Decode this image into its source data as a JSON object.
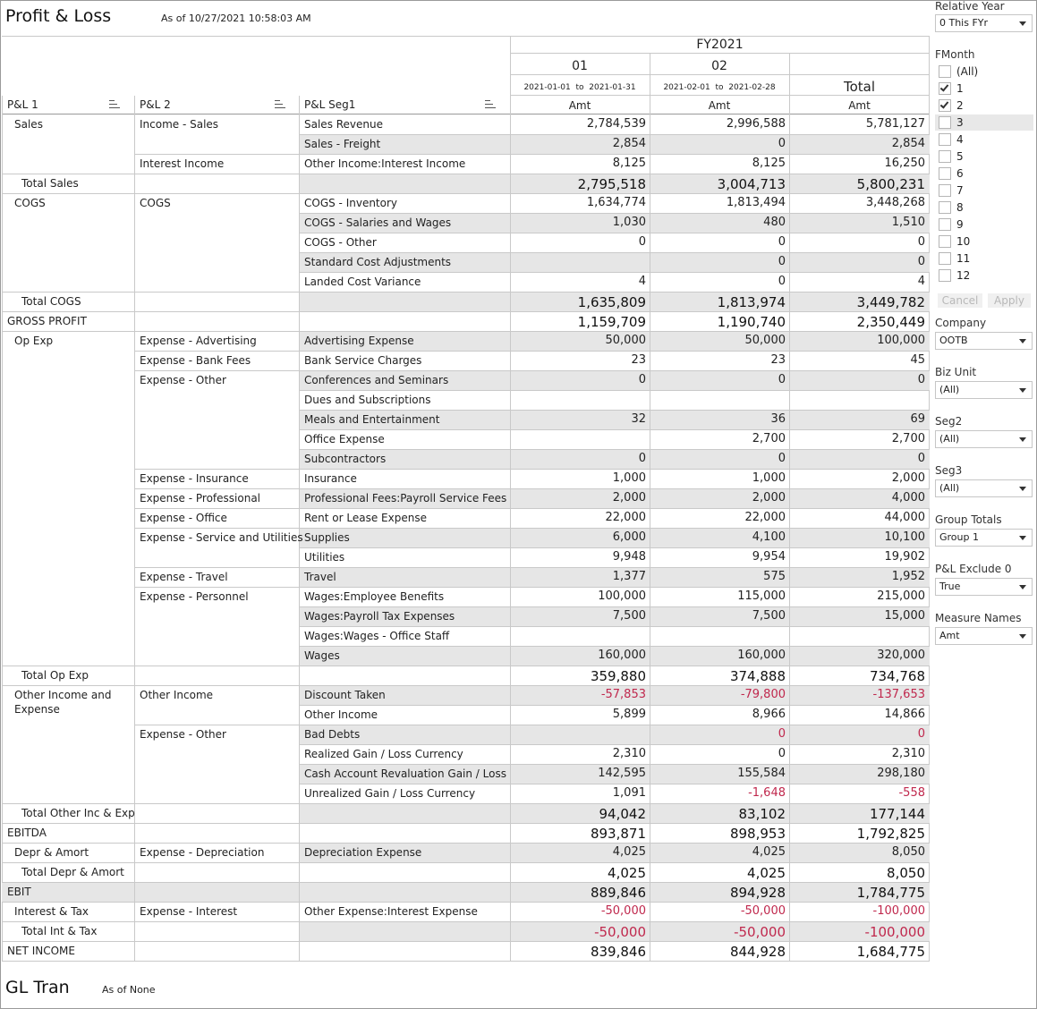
{
  "title": "Profit & Loss",
  "as_of": "As of 10/27/2021 10:58:03 AM",
  "gl_title": "GL Tran",
  "gl_as_of": "As of None",
  "header": {
    "fy": "FY2021",
    "periods": [
      "01",
      "02"
    ],
    "ranges": [
      "2021-01-01  to  2021-01-31",
      "2021-02-01  to  2021-02-28"
    ],
    "total": "Total",
    "measure": "Amt",
    "col1": "P&L 1",
    "col2": "P&L 2",
    "col3": "P&L Seg1"
  },
  "rows": [
    {
      "c1": "Sales",
      "c2": "Income - Sales",
      "c3": "Sales Revenue",
      "v": [
        "2,784,539",
        "2,996,588",
        "5,781,127"
      ]
    },
    {
      "c1": "",
      "c2": "",
      "c3": "Sales - Freight",
      "v": [
        "2,854",
        "0",
        "2,854"
      ],
      "shade": true
    },
    {
      "c1": "",
      "c2": "Interest Income",
      "c3": "Other Income:Interest Income",
      "v": [
        "8,125",
        "8,125",
        "16,250"
      ]
    },
    {
      "c1": "Total Sales",
      "c2": "",
      "c3": "",
      "v": [
        "2,795,518",
        "3,004,713",
        "5,800,231"
      ],
      "shade": true,
      "total": true
    },
    {
      "c1": "COGS",
      "c2": "COGS",
      "c3": "COGS - Inventory",
      "v": [
        "1,634,774",
        "1,813,494",
        "3,448,268"
      ]
    },
    {
      "c1": "",
      "c2": "",
      "c3": "COGS - Salaries and Wages",
      "v": [
        "1,030",
        "480",
        "1,510"
      ],
      "shade": true
    },
    {
      "c1": "",
      "c2": "",
      "c3": "COGS - Other",
      "v": [
        "0",
        "0",
        "0"
      ]
    },
    {
      "c1": "",
      "c2": "",
      "c3": "Standard Cost Adjustments",
      "v": [
        "",
        "0",
        "0"
      ],
      "shade": true
    },
    {
      "c1": "",
      "c2": "",
      "c3": "Landed Cost Variance",
      "v": [
        "4",
        "0",
        "4"
      ]
    },
    {
      "c1": "Total COGS",
      "c2": "",
      "c3": "",
      "v": [
        "1,635,809",
        "1,813,974",
        "3,449,782"
      ],
      "shade": true,
      "total": true
    },
    {
      "c1": "GROSS PROFIT",
      "c2": "",
      "c3": "",
      "v": [
        "1,159,709",
        "1,190,740",
        "2,350,449"
      ],
      "grand": true
    },
    {
      "c1": "Op Exp",
      "c2": "Expense - Advertising",
      "c3": "Advertising Expense",
      "v": [
        "50,000",
        "50,000",
        "100,000"
      ],
      "shade": true
    },
    {
      "c1": "",
      "c2": "Expense - Bank Fees",
      "c3": "Bank Service Charges",
      "v": [
        "23",
        "23",
        "45"
      ]
    },
    {
      "c1": "",
      "c2": "Expense - Other",
      "c3": "Conferences and Seminars",
      "v": [
        "0",
        "0",
        "0"
      ],
      "shade": true
    },
    {
      "c1": "",
      "c2": "",
      "c3": "Dues and Subscriptions",
      "v": [
        "",
        "",
        ""
      ]
    },
    {
      "c1": "",
      "c2": "",
      "c3": "Meals and Entertainment",
      "v": [
        "32",
        "36",
        "69"
      ],
      "shade": true
    },
    {
      "c1": "",
      "c2": "",
      "c3": "Office Expense",
      "v": [
        "",
        "2,700",
        "2,700"
      ]
    },
    {
      "c1": "",
      "c2": "",
      "c3": "Subcontractors",
      "v": [
        "0",
        "0",
        "0"
      ],
      "shade": true
    },
    {
      "c1": "",
      "c2": "Expense - Insurance",
      "c3": "Insurance",
      "v": [
        "1,000",
        "1,000",
        "2,000"
      ]
    },
    {
      "c1": "",
      "c2": "Expense - Professional",
      "c3": "Professional Fees:Payroll Service Fees",
      "v": [
        "2,000",
        "2,000",
        "4,000"
      ],
      "shade": true
    },
    {
      "c1": "",
      "c2": "Expense - Office",
      "c3": "Rent or Lease Expense",
      "v": [
        "22,000",
        "22,000",
        "44,000"
      ]
    },
    {
      "c1": "",
      "c2": "Expense - Service and Utilities",
      "c3": "Supplies",
      "v": [
        "6,000",
        "4,100",
        "10,100"
      ],
      "shade": true
    },
    {
      "c1": "",
      "c2": "",
      "c3": "Utilities",
      "v": [
        "9,948",
        "9,954",
        "19,902"
      ]
    },
    {
      "c1": "",
      "c2": "Expense - Travel",
      "c3": "Travel",
      "v": [
        "1,377",
        "575",
        "1,952"
      ],
      "shade": true
    },
    {
      "c1": "",
      "c2": "Expense - Personnel",
      "c3": "Wages:Employee Benefits",
      "v": [
        "100,000",
        "115,000",
        "215,000"
      ]
    },
    {
      "c1": "",
      "c2": "",
      "c3": "Wages:Payroll Tax Expenses",
      "v": [
        "7,500",
        "7,500",
        "15,000"
      ],
      "shade": true
    },
    {
      "c1": "",
      "c2": "",
      "c3": "Wages:Wages - Office Staff",
      "v": [
        "",
        "",
        ""
      ]
    },
    {
      "c1": "",
      "c2": "",
      "c3": "Wages",
      "v": [
        "160,000",
        "160,000",
        "320,000"
      ],
      "shade": true
    },
    {
      "c1": "Total Op Exp",
      "c2": "",
      "c3": "",
      "v": [
        "359,880",
        "374,888",
        "734,768"
      ],
      "total": true
    },
    {
      "c1": "Other Income and\nExpense",
      "c2": "Other Income",
      "c3": "Discount Taken",
      "v": [
        "-57,853",
        "-79,800",
        "-137,653"
      ],
      "shade": true,
      "neg": [
        true,
        true,
        true
      ]
    },
    {
      "c1": "",
      "c2": "",
      "c3": "Other Income",
      "v": [
        "5,899",
        "8,966",
        "14,866"
      ]
    },
    {
      "c1": "",
      "c2": "Expense - Other",
      "c3": "Bad Debts",
      "v": [
        "",
        "0",
        "0"
      ],
      "shade": true,
      "neg": [
        false,
        true,
        true
      ]
    },
    {
      "c1": "",
      "c2": "",
      "c3": "Realized Gain / Loss Currency",
      "v": [
        "2,310",
        "0",
        "2,310"
      ]
    },
    {
      "c1": "",
      "c2": "",
      "c3": "Cash Account Revaluation Gain / Loss",
      "v": [
        "142,595",
        "155,584",
        "298,180"
      ],
      "shade": true
    },
    {
      "c1": "",
      "c2": "",
      "c3": "Unrealized Gain / Loss Currency",
      "v": [
        "1,091",
        "-1,648",
        "-558"
      ],
      "neg": [
        false,
        true,
        true
      ]
    },
    {
      "c1": "Total Other Inc & Exp",
      "c2": "",
      "c3": "",
      "v": [
        "94,042",
        "83,102",
        "177,144"
      ],
      "shade": true,
      "total": true
    },
    {
      "c1": "EBITDA",
      "c2": "",
      "c3": "",
      "v": [
        "893,871",
        "898,953",
        "1,792,825"
      ],
      "grand": true
    },
    {
      "c1": "Depr & Amort",
      "c2": "Expense - Depreciation",
      "c3": "Depreciation Expense",
      "v": [
        "4,025",
        "4,025",
        "8,050"
      ],
      "shade": true
    },
    {
      "c1": "Total Depr & Amort",
      "c2": "",
      "c3": "",
      "v": [
        "4,025",
        "4,025",
        "8,050"
      ],
      "total": true
    },
    {
      "c1": "EBIT",
      "c2": "",
      "c3": "",
      "v": [
        "889,846",
        "894,928",
        "1,784,775"
      ],
      "grand": true,
      "shadeAll": true
    },
    {
      "c1": "Interest & Tax",
      "c2": "Expense - Interest",
      "c3": "Other Expense:Interest Expense",
      "v": [
        "-50,000",
        "-50,000",
        "-100,000"
      ],
      "neg": [
        true,
        true,
        true
      ]
    },
    {
      "c1": "Total Int & Tax",
      "c2": "",
      "c3": "",
      "v": [
        "-50,000",
        "-50,000",
        "-100,000"
      ],
      "shade": true,
      "total": true,
      "neg": [
        true,
        true,
        true
      ]
    },
    {
      "c1": "NET INCOME",
      "c2": "",
      "c3": "",
      "v": [
        "839,846",
        "844,928",
        "1,684,775"
      ],
      "grand": true
    }
  ],
  "filters": {
    "relative_year": {
      "label": "Relative Year",
      "value": "0 This FYr"
    },
    "fmonth": {
      "label": "FMonth",
      "options": [
        {
          "label": "(All)",
          "checked": false
        },
        {
          "label": "1",
          "checked": true
        },
        {
          "label": "2",
          "checked": true
        },
        {
          "label": "3",
          "checked": false,
          "hover": true
        },
        {
          "label": "4",
          "checked": false
        },
        {
          "label": "5",
          "checked": false
        },
        {
          "label": "6",
          "checked": false
        },
        {
          "label": "7",
          "checked": false
        },
        {
          "label": "8",
          "checked": false
        },
        {
          "label": "9",
          "checked": false
        },
        {
          "label": "10",
          "checked": false
        },
        {
          "label": "11",
          "checked": false
        },
        {
          "label": "12",
          "checked": false
        }
      ]
    },
    "cancel": "Cancel",
    "apply": "Apply",
    "dropdowns": [
      {
        "label": "Company",
        "value": "OOTB"
      },
      {
        "label": "Biz Unit",
        "value": "(All)"
      },
      {
        "label": "Seg2",
        "value": "(All)"
      },
      {
        "label": "Seg3",
        "value": "(All)"
      },
      {
        "label": "Group Totals",
        "value": "Group 1"
      },
      {
        "label": "P&L Exclude 0",
        "value": "True"
      },
      {
        "label": "Measure Names",
        "value": "Amt"
      }
    ]
  }
}
